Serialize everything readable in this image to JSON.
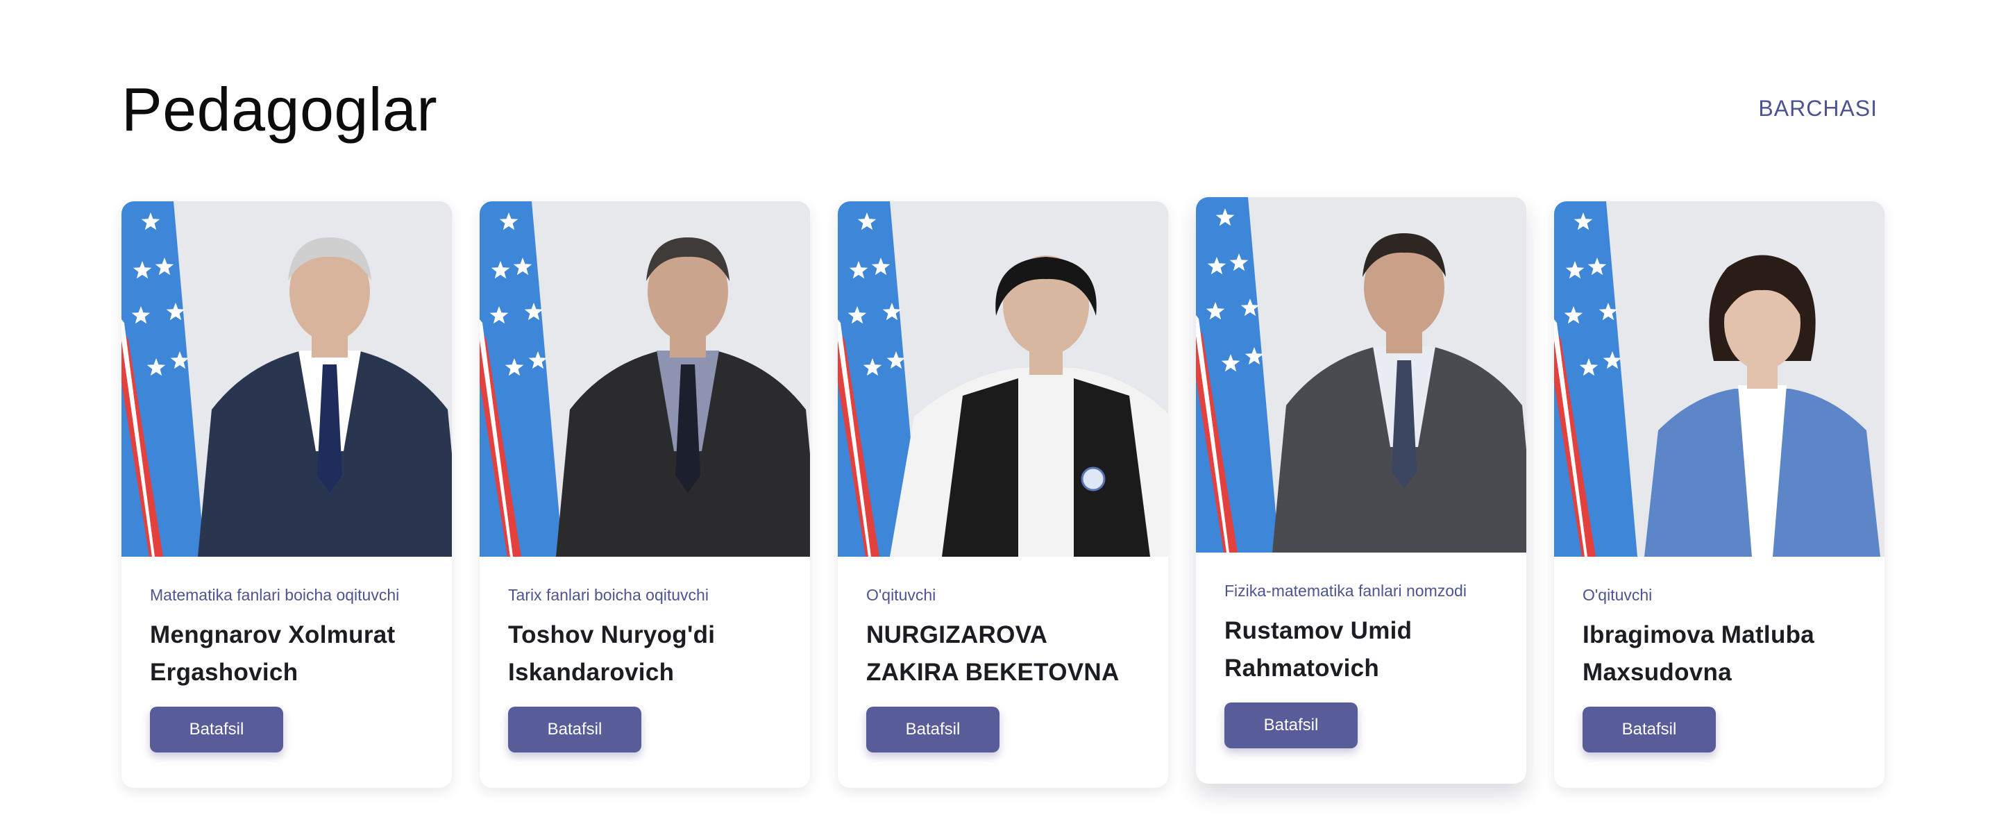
{
  "section": {
    "title": "Pedagoglar",
    "view_all_label": "BARCHASI"
  },
  "teachers": [
    {
      "role": "Matematika fanlari boicha oqituvchi",
      "name": "Mengnarov Xolmurat Ergashovich",
      "button_label": "Batafsil",
      "photo": {
        "hair": "#cfcfcf",
        "skin": "#d9b49c",
        "suit": "#2a3650",
        "shirt": "#ffffff",
        "tie": "#1e2d5c",
        "style": "man"
      }
    },
    {
      "role": "Tarix fanlari boicha oqituvchi",
      "name": "Toshov Nuryog'di Iskandarovich",
      "button_label": "Batafsil",
      "photo": {
        "hair": "#3f3b38",
        "skin": "#caa48c",
        "suit": "#2b2b2e",
        "shirt": "#8e93b2",
        "tie": "#1c1f2c",
        "style": "man"
      }
    },
    {
      "role": "O'qituvchi",
      "name": "NURGIZAROVA ZAKIRA BEKETOVNA",
      "button_label": "Batafsil",
      "photo": {
        "hair": "#161616",
        "skin": "#d8b7a0",
        "suit": "#1b1b1b",
        "shirt": "#f3f3f3",
        "tie": "#f3f3f3",
        "style": "woman-vest"
      }
    },
    {
      "role": "Fizika-matematika fanlari nomzodi",
      "name": "Rustamov Umid Rahmatovich",
      "button_label": "Batafsil",
      "photo": {
        "hair": "#2d2622",
        "skin": "#c9a188",
        "suit": "#4a4b50",
        "shirt": "#e9ecf2",
        "tie": "#3c4660",
        "style": "man"
      }
    },
    {
      "role": "O'qituvchi",
      "name": "Ibragimova Matluba Maxsudovna",
      "button_label": "Batafsil",
      "photo": {
        "hair": "#2a1d18",
        "skin": "#e3c2ad",
        "suit": "#5c86c8",
        "shirt": "#ffffff",
        "tie": "#ffffff",
        "style": "woman-blazer"
      }
    }
  ]
}
